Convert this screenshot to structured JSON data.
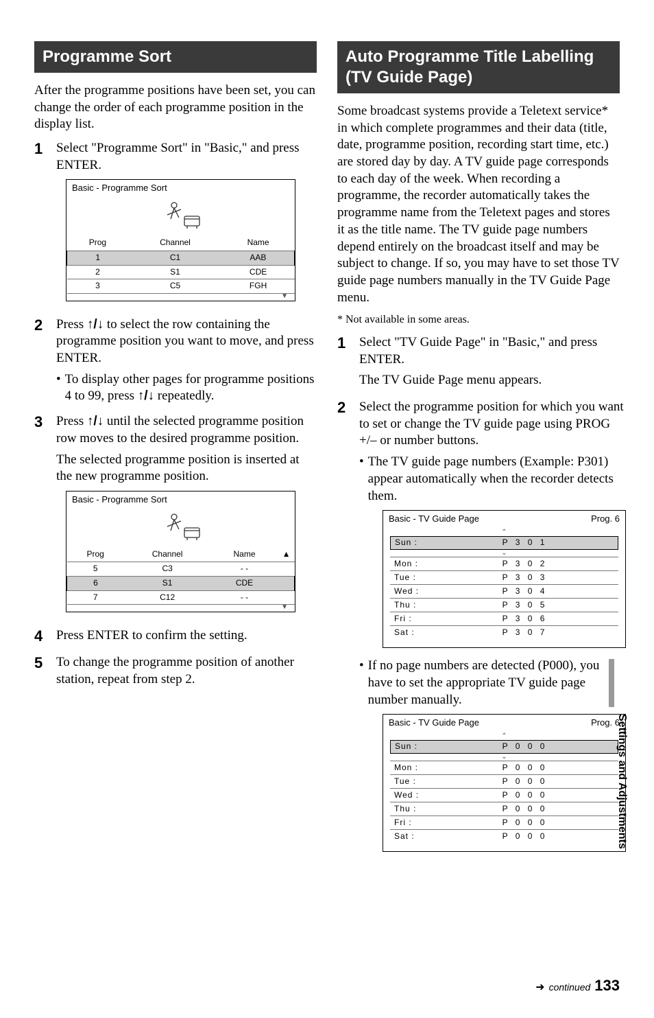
{
  "left": {
    "header": "Programme Sort",
    "intro": "After the programme positions have been set, you can change the order of each programme position in the display list.",
    "step1": "Select \"Programme Sort\" in \"Basic,\" and press ENTER.",
    "shot1": {
      "title": "Basic - Programme Sort",
      "cols": [
        "Prog",
        "Channel",
        "Name"
      ],
      "rows": [
        {
          "sel": true,
          "prog": "1",
          "channel": "C1",
          "name": "AAB"
        },
        {
          "sel": false,
          "prog": "2",
          "channel": "S1",
          "name": "CDE"
        },
        {
          "sel": false,
          "prog": "3",
          "channel": "C5",
          "name": "FGH"
        }
      ]
    },
    "step2_a": "Press ",
    "step2_b": " to select the row containing the programme position you want to move, and press ENTER.",
    "step2_bullet_a": "To display other pages for programme positions 4 to 99, press ",
    "step2_bullet_b": " repeatedly.",
    "step3_a": "Press ",
    "step3_b": " until the selected programme position row moves to the desired programme position.",
    "step3_c": "The selected programme position is inserted at the new programme position.",
    "shot2": {
      "title": "Basic - Programme Sort",
      "cols": [
        "Prog",
        "Channel",
        "Name"
      ],
      "rows": [
        {
          "sel": false,
          "prog": "5",
          "channel": "C3",
          "name": "- -"
        },
        {
          "sel": true,
          "prog": "6",
          "channel": "S1",
          "name": "CDE"
        },
        {
          "sel": false,
          "prog": "7",
          "channel": "C12",
          "name": "- -"
        }
      ]
    },
    "step4": "Press ENTER to confirm the setting.",
    "step5": "To change the programme position of another station, repeat from step 2."
  },
  "right": {
    "header": "Auto Programme Title Labelling (TV Guide Page)",
    "intro": "Some broadcast systems provide a Teletext service* in which complete programmes and their data (title, date, programme position, recording start time, etc.) are stored day by day. A TV guide page corresponds to each day of the week. When recording a programme, the recorder automatically takes the programme name from the Teletext pages and stores it as the title name. The TV guide page numbers depend entirely on the broadcast itself and may be subject to change. If so, you may have to set those TV guide page numbers manually in the TV Guide Page menu.",
    "foot": "* Not available in some areas.",
    "step1_a": "Select \"TV Guide Page\" in \"Basic,\" and press ENTER.",
    "step1_b": "The TV Guide Page menu appears.",
    "step2_a": "Select the programme position for which you want to set or change the TV guide page using PROG +/– or number buttons.",
    "step2_bullet": "The TV guide page numbers (Example: P301) appear automatically when the recorder detects them.",
    "shot1": {
      "title": "Basic - TV Guide Page",
      "prog": "Prog. 6",
      "days": [
        {
          "sel": true,
          "day": "Sun :",
          "val": "P 3 0 1"
        },
        {
          "sel": false,
          "day": "Mon :",
          "val": "P 3 0 2"
        },
        {
          "sel": false,
          "day": "Tue :",
          "val": "P 3 0 3"
        },
        {
          "sel": false,
          "day": "Wed :",
          "val": "P 3 0 4"
        },
        {
          "sel": false,
          "day": "Thu :",
          "val": "P 3 0 5"
        },
        {
          "sel": false,
          "day": "Fri :",
          "val": "P 3 0 6"
        },
        {
          "sel": false,
          "day": "Sat :",
          "val": "P 3 0 7"
        }
      ]
    },
    "bullet2": "If no page numbers are detected (P000), you have to set the appropriate TV guide page number manually.",
    "shot2": {
      "title": "Basic - TV Guide Page",
      "prog": "Prog. 6",
      "days": [
        {
          "sel": true,
          "day": "Sun :",
          "val": "P 0 0 0"
        },
        {
          "sel": false,
          "day": "Mon :",
          "val": "P 0 0 0"
        },
        {
          "sel": false,
          "day": "Tue :",
          "val": "P 0 0 0"
        },
        {
          "sel": false,
          "day": "Wed :",
          "val": "P 0 0 0"
        },
        {
          "sel": false,
          "day": "Thu :",
          "val": "P 0 0 0"
        },
        {
          "sel": false,
          "day": "Fri :",
          "val": "P 0 0 0"
        },
        {
          "sel": false,
          "day": "Sat :",
          "val": "P 0 0 0"
        }
      ]
    }
  },
  "side": "Settings and Adjustments",
  "footer_cont": "continued",
  "footer_page": "133",
  "arrows": "↑/↓"
}
